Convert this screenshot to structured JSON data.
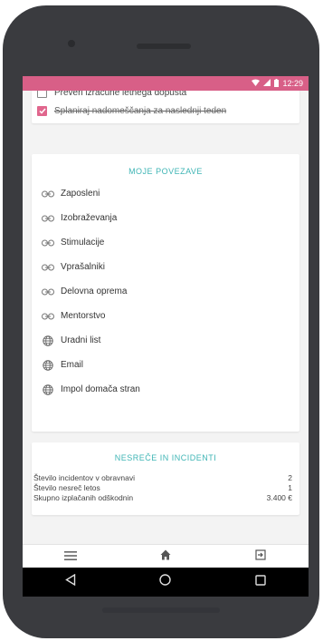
{
  "caption": "",
  "status_bar": {
    "time": "12:29",
    "icons": [
      "wifi-icon",
      "signal-icon",
      "battery-icon"
    ]
  },
  "todos": [
    {
      "label": "Preveri izračune letnega dopusta",
      "checked": false
    },
    {
      "label": "Splaniraj nadomeščanja za naslednji teden",
      "checked": true
    }
  ],
  "links_section": {
    "title": "MOJE POVEZAVE",
    "items": [
      {
        "label": "Zaposleni",
        "icon": "link-icon"
      },
      {
        "label": "Izobraževanja",
        "icon": "link-icon"
      },
      {
        "label": "Stimulacije",
        "icon": "link-icon"
      },
      {
        "label": "Vprašalniki",
        "icon": "link-icon"
      },
      {
        "label": "Delovna oprema",
        "icon": "link-icon"
      },
      {
        "label": "Mentorstvo",
        "icon": "link-icon"
      },
      {
        "label": "Uradni list",
        "icon": "globe-icon"
      },
      {
        "label": "Email",
        "icon": "globe-icon"
      },
      {
        "label": "Impol domača stran",
        "icon": "globe-icon"
      }
    ]
  },
  "incidents_section": {
    "title": "NESREČE IN INCIDENTI",
    "rows": [
      {
        "label": "Število incidentov v obravnavi",
        "value": "2"
      },
      {
        "label": "Število nesreč letos",
        "value": "1"
      },
      {
        "label": "Skupno izplačanih odškodnin",
        "value": "3.400 €"
      }
    ]
  },
  "bottom_nav": {
    "items": [
      "menu-icon",
      "home-icon",
      "logout-icon"
    ]
  },
  "android_nav": {
    "items": [
      "back-icon",
      "home-circle-icon",
      "recents-icon"
    ]
  },
  "colors": {
    "accent_pink": "#e0668d",
    "accent_teal": "#3fb5b5",
    "status_bar": "#d85f87"
  }
}
